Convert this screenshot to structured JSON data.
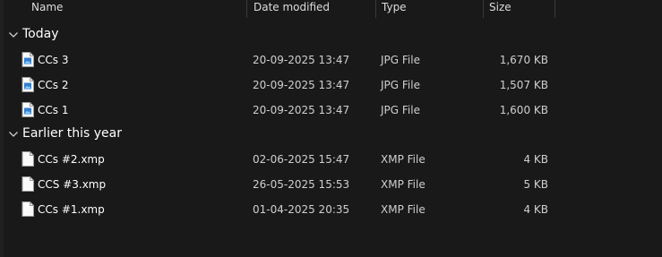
{
  "columns": {
    "name": "Name",
    "date_modified": "Date modified",
    "type": "Type",
    "size": "Size"
  },
  "groups": [
    {
      "label": "Today",
      "files": [
        {
          "name": "CCs 3",
          "date": "20-09-2025 13:47",
          "type": "JPG File",
          "size": "1,670 KB",
          "icon": "jpg-file-icon"
        },
        {
          "name": "CCs 2",
          "date": "20-09-2025 13:47",
          "type": "JPG File",
          "size": "1,507 KB",
          "icon": "jpg-file-icon"
        },
        {
          "name": "CCs 1",
          "date": "20-09-2025 13:47",
          "type": "JPG File",
          "size": "1,600 KB",
          "icon": "jpg-file-icon"
        }
      ]
    },
    {
      "label": "Earlier this year",
      "files": [
        {
          "name": "CCs #2.xmp",
          "date": "02-06-2025 15:47",
          "type": "XMP File",
          "size": "4 KB",
          "icon": "xmp-file-icon"
        },
        {
          "name": "CCS #3.xmp",
          "date": "26-05-2025 15:53",
          "type": "XMP File",
          "size": "5 KB",
          "icon": "xmp-file-icon"
        },
        {
          "name": "CCs #1.xmp",
          "date": "01-04-2025 20:35",
          "type": "XMP File",
          "size": "4 KB",
          "icon": "xmp-file-icon"
        }
      ]
    }
  ],
  "colors": {
    "background": "#191919",
    "text": "#ffffff",
    "secondary_text": "#cfcfcf",
    "column_separator": "#3a3a3a",
    "image_icon_accent": "#2f7fd1"
  }
}
